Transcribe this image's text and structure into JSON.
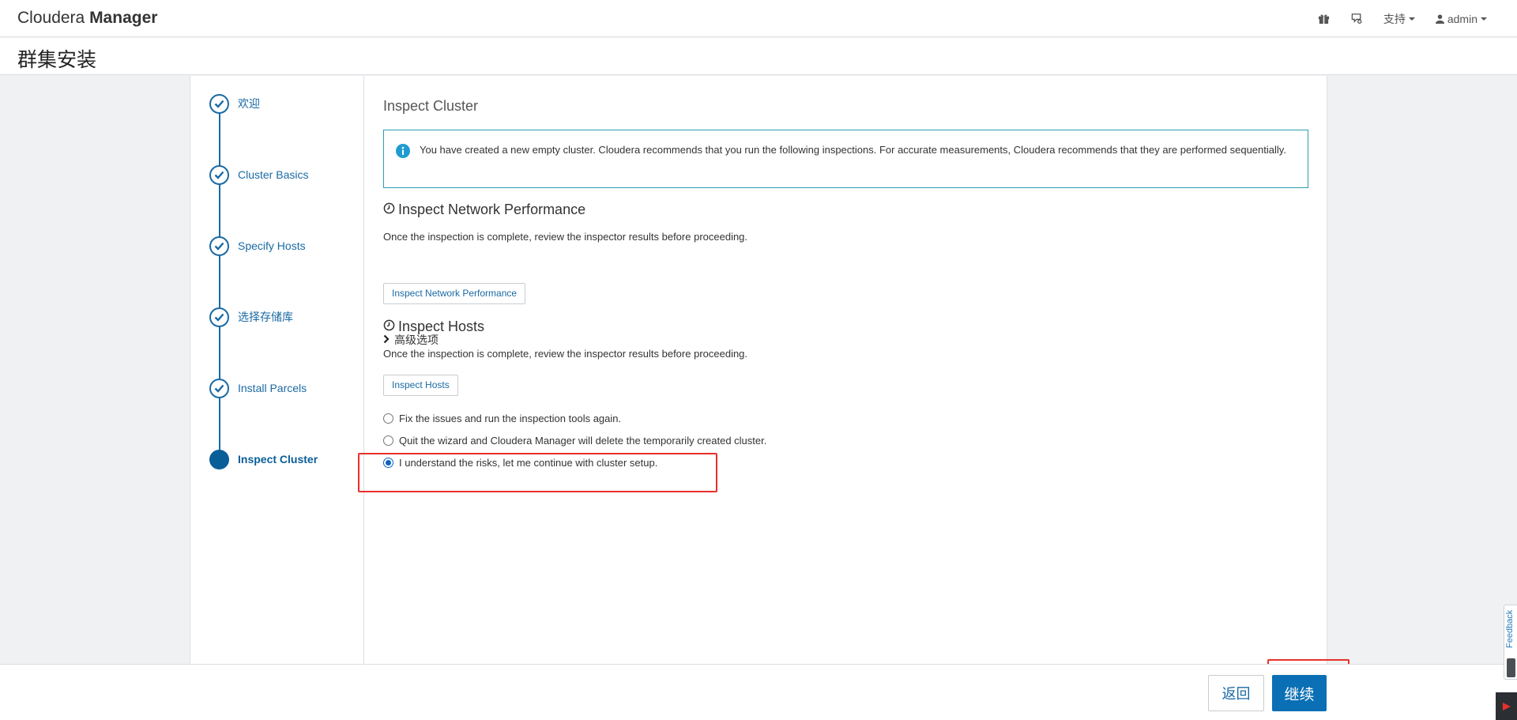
{
  "app": {
    "brand_light": "Cloudera ",
    "brand_bold": "Manager"
  },
  "topnav": {
    "support_label": "支持",
    "user_label": "admin",
    "icons": [
      "gift-icon",
      "tour-icon",
      "user-icon"
    ]
  },
  "page": {
    "title": "群集安装"
  },
  "steps": [
    {
      "label": "欢迎",
      "state": "done"
    },
    {
      "label": "Cluster Basics",
      "state": "done"
    },
    {
      "label": "Specify Hosts",
      "state": "done"
    },
    {
      "label": "选择存储库",
      "state": "done"
    },
    {
      "label": "Install Parcels",
      "state": "done"
    },
    {
      "label": "Inspect Cluster",
      "state": "active"
    }
  ],
  "content": {
    "title": "Inspect Cluster",
    "info_text": "You have created a new empty cluster. Cloudera recommends that you run the following inspections. For accurate measurements, Cloudera recommends that they are performed sequentially.",
    "network": {
      "title": "Inspect Network Performance",
      "description": "Once the inspection is complete, review the inspector results before proceeding.",
      "advanced_label": "高级选项",
      "button_label": "Inspect Network Performance"
    },
    "hosts": {
      "title": "Inspect Hosts",
      "description": "Once the inspection is complete, review the inspector results before proceeding.",
      "button_label": "Inspect Hosts"
    },
    "options": [
      {
        "label": "Fix the issues and run the inspection tools again.",
        "checked": false
      },
      {
        "label": "Quit the wizard and Cloudera Manager will delete the temporarily created cluster.",
        "checked": false
      },
      {
        "label": "I understand the risks, let me continue with cluster setup.",
        "checked": true
      }
    ]
  },
  "footer": {
    "back_label": "返回",
    "continue_label": "继续"
  },
  "feedback": {
    "label": "Feedback"
  },
  "colors": {
    "accent": "#0a6fb4",
    "link": "#1a6aa4",
    "info_border": "#2a9db0",
    "highlight": "#e8302c"
  }
}
